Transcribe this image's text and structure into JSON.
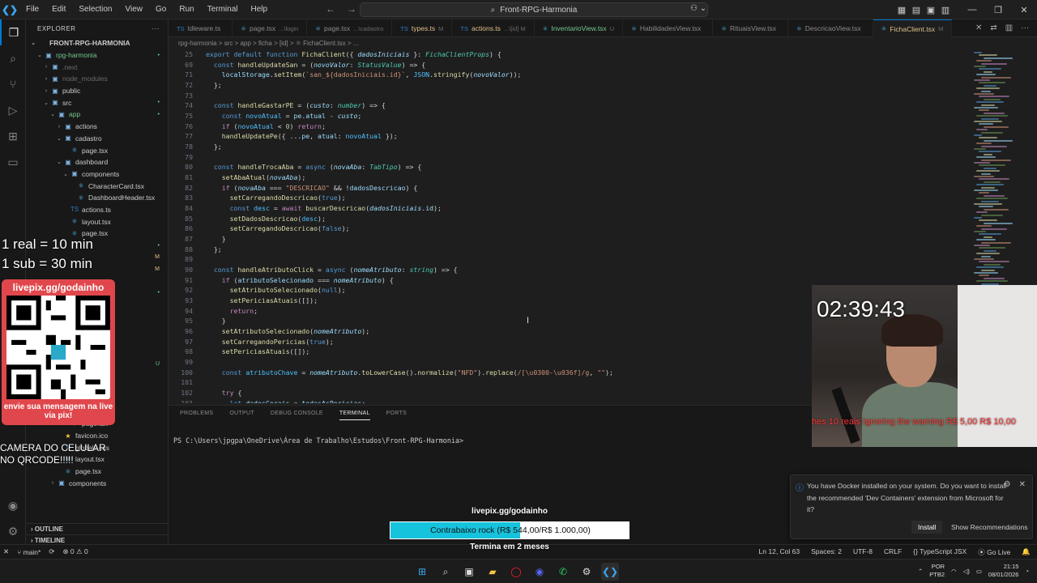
{
  "menu": [
    "File",
    "Edit",
    "Selection",
    "View",
    "Go",
    "Run",
    "Terminal",
    "Help"
  ],
  "search": {
    "text": "Front-RPG-Harmonia"
  },
  "sidebar": {
    "title": "EXPLORER",
    "rows": [
      {
        "label": "FRONT-RPG-HARMONIA",
        "indent": 0,
        "chev": "⌄",
        "icon": "",
        "color": "#ccc",
        "bold": true,
        "badge": ""
      },
      {
        "label": "rpg-harmonia",
        "indent": 1,
        "chev": "⌄",
        "icon": "▣",
        "color": "#73c991",
        "bold": false,
        "badge": "•"
      },
      {
        "label": ".next",
        "indent": 2,
        "chev": "›",
        "icon": "▣",
        "color": "#6b6b6b",
        "bold": false,
        "badge": ""
      },
      {
        "label": "node_modules",
        "indent": 2,
        "chev": "›",
        "icon": "▣",
        "color": "#6b6b6b",
        "bold": false,
        "badge": ""
      },
      {
        "label": "public",
        "indent": 2,
        "chev": "›",
        "icon": "▣",
        "color": "#ccc",
        "bold": false,
        "badge": ""
      },
      {
        "label": "src",
        "indent": 2,
        "chev": "⌄",
        "icon": "▣",
        "color": "#ccc",
        "bold": false,
        "badge": "•"
      },
      {
        "label": "app",
        "indent": 3,
        "chev": "⌄",
        "icon": "▣",
        "color": "#73c991",
        "bold": false,
        "badge": "•"
      },
      {
        "label": "actions",
        "indent": 4,
        "chev": "›",
        "icon": "▣",
        "color": "#ccc",
        "bold": false,
        "badge": ""
      },
      {
        "label": "cadastro",
        "indent": 4,
        "chev": "⌄",
        "icon": "▣",
        "color": "#ccc",
        "bold": false,
        "badge": ""
      },
      {
        "label": "page.tsx",
        "indent": 5,
        "chev": "",
        "icon": "⚛",
        "color": "#ccc",
        "bold": false,
        "badge": ""
      },
      {
        "label": "dashboard",
        "indent": 4,
        "chev": "⌄",
        "icon": "▣",
        "color": "#ccc",
        "bold": false,
        "badge": ""
      },
      {
        "label": "components",
        "indent": 5,
        "chev": "⌄",
        "icon": "▣",
        "color": "#ccc",
        "bold": false,
        "badge": ""
      },
      {
        "label": "CharacterCard.tsx",
        "indent": 6,
        "chev": "",
        "icon": "⚛",
        "color": "#ccc",
        "bold": false,
        "badge": ""
      },
      {
        "label": "DashboardHeader.tsx",
        "indent": 6,
        "chev": "",
        "icon": "⚛",
        "color": "#ccc",
        "bold": false,
        "badge": ""
      },
      {
        "label": "actions.ts",
        "indent": 5,
        "chev": "",
        "icon": "TS",
        "color": "#ccc",
        "bold": false,
        "badge": ""
      },
      {
        "label": "layout.tsx",
        "indent": 5,
        "chev": "",
        "icon": "⚛",
        "color": "#ccc",
        "bold": false,
        "badge": ""
      },
      {
        "label": "page.tsx",
        "indent": 5,
        "chev": "",
        "icon": "⚛",
        "color": "#ccc",
        "bold": false,
        "badge": ""
      },
      {
        "label": "",
        "indent": 4,
        "chev": "",
        "icon": "",
        "color": "#ccc",
        "bold": false,
        "badge": "•"
      },
      {
        "label": "",
        "indent": 4,
        "chev": "",
        "icon": "",
        "color": "#ccc",
        "bold": false,
        "badge": "M"
      },
      {
        "label": "",
        "indent": 4,
        "chev": "",
        "icon": "",
        "color": "#ccc",
        "bold": false,
        "badge": "M"
      },
      {
        "label": "",
        "indent": 4,
        "chev": "",
        "icon": "",
        "color": "#ccc",
        "bold": false,
        "badge": ""
      },
      {
        "label": "",
        "indent": 4,
        "chev": "",
        "icon": "",
        "color": "#ccc",
        "bold": false,
        "badge": "•"
      },
      {
        "label": ".tsx",
        "indent": 5,
        "chev": "",
        "icon": "",
        "color": "#ccc",
        "bold": false,
        "badge": ""
      },
      {
        "label": "w.tsx",
        "indent": 5,
        "chev": "",
        "icon": "",
        "color": "#ccc",
        "bold": false,
        "badge": ""
      },
      {
        "label": "ew.tsx",
        "indent": 5,
        "chev": "",
        "icon": "",
        "color": "#ccc",
        "bold": false,
        "badge": ""
      },
      {
        "label": "sx",
        "indent": 5,
        "chev": "",
        "icon": "",
        "color": "#ccc",
        "bold": false,
        "badge": ""
      },
      {
        "label": "em.tsx",
        "indent": 5,
        "chev": "",
        "icon": "",
        "color": "#ccc",
        "bold": false,
        "badge": ""
      },
      {
        "label": "w.tsx",
        "indent": 5,
        "chev": "",
        "icon": "",
        "color": "#73c991",
        "bold": false,
        "badge": "U"
      },
      {
        "label": "sx",
        "indent": 5,
        "chev": "",
        "icon": "",
        "color": "#ccc",
        "bold": false,
        "badge": ""
      },
      {
        "label": "arios.tsx",
        "indent": 5,
        "chev": "",
        "icon": "",
        "color": "#ccc",
        "bold": false,
        "badge": ""
      },
      {
        "label": "",
        "indent": 5,
        "chev": "",
        "icon": "",
        "color": "#ccc",
        "bold": false,
        "badge": ""
      },
      {
        "label": "layout.tsx",
        "indent": 5,
        "chev": "",
        "icon": "⚛",
        "color": "#ccc",
        "bold": false,
        "badge": ""
      },
      {
        "label": "page.tsx",
        "indent": 5,
        "chev": "",
        "icon": "⚛",
        "color": "#ccc",
        "bold": false,
        "badge": ""
      },
      {
        "label": "favicon.ico",
        "indent": 4,
        "chev": "",
        "icon": "★",
        "color": "#ccc",
        "bold": false,
        "badge": ""
      },
      {
        "label": "globals.css",
        "indent": 4,
        "chev": "",
        "icon": "#",
        "color": "#ccc",
        "bold": false,
        "badge": ""
      },
      {
        "label": "layout.tsx",
        "indent": 4,
        "chev": "",
        "icon": "⚛",
        "color": "#ccc",
        "bold": false,
        "badge": ""
      },
      {
        "label": "page.tsx",
        "indent": 4,
        "chev": "",
        "icon": "⚛",
        "color": "#ccc",
        "bold": false,
        "badge": ""
      },
      {
        "label": "components",
        "indent": 3,
        "chev": "›",
        "icon": "▣",
        "color": "#ccc",
        "bold": false,
        "badge": ""
      }
    ],
    "outline": "OUTLINE",
    "timeline": "TIMELINE"
  },
  "tabs": [
    {
      "label": "ldleware.ts",
      "hint": "",
      "state": "normal"
    },
    {
      "label": "page.tsx",
      "hint": "...\\login",
      "state": "normal"
    },
    {
      "label": "page.tsx",
      "hint": "...\\cadastro",
      "state": "normal"
    },
    {
      "label": "types.ts",
      "hint": "M",
      "state": "mod"
    },
    {
      "label": "actions.ts",
      "hint": "...\\[id] M",
      "state": "mod"
    },
    {
      "label": "InventarioView.tsx",
      "hint": "U",
      "state": "untr"
    },
    {
      "label": "HabilidadesView.tsx",
      "hint": "",
      "state": "normal"
    },
    {
      "label": "RituaisView.tsx",
      "hint": "",
      "state": "normal"
    },
    {
      "label": "DescricaoView.tsx",
      "hint": "",
      "state": "normal"
    },
    {
      "label": "FichaClient.tsx",
      "hint": "M",
      "state": "active"
    }
  ],
  "breadcrumb": "rpg-harmonia > src > app > ficha > [id] > ⚛ FichaClient.tsx > ...",
  "code": [
    {
      "n": "25",
      "t": "<span class=\"kw\">export default function</span> <span class=\"fn\">FichaClient</span>({ <span class=\"param\">dadosIniciais</span> }: <span class=\"ty\">FichaClientProps</span>) {"
    },
    {
      "n": "69",
      "t": "  <span class=\"kw\">const</span> <span class=\"fn\">handleUpdateSan</span> = (<span class=\"param\">novoValor</span>: <span class=\"ty\">StatusValue</span>) => {"
    },
    {
      "n": "71",
      "t": "    <span class=\"var\">localStorage</span>.<span class=\"fn\">setItem</span>(<span class=\"str\">`san_${dadosIniciais.id}`</span>, <span class=\"cst\">JSON</span>.<span class=\"fn\">stringify</span>(<span class=\"param\">novoValor</span>));"
    },
    {
      "n": "72",
      "t": "  };"
    },
    {
      "n": "73",
      "t": ""
    },
    {
      "n": "74",
      "t": "  <span class=\"kw\">const</span> <span class=\"fn\">handleGastarPE</span> = (<span class=\"param\">custo</span>: <span class=\"ty\">number</span>) => {"
    },
    {
      "n": "75",
      "t": "    <span class=\"kw\">const</span> <span class=\"cst\">novoAtual</span> = <span class=\"var\">pe</span>.<span class=\"var\">atual</span> - <span class=\"param\">custo</span>;"
    },
    {
      "n": "76",
      "t": "    <span class=\"ctl\">if</span> (<span class=\"cst\">novoAtual</span> < <span class=\"num\">0</span>) <span class=\"ctl\">return</span>;"
    },
    {
      "n": "77",
      "t": "    <span class=\"fn\">handleUpdatePe</span>({ ...<span class=\"var\">pe</span>, <span class=\"var\">atual</span>: <span class=\"cst\">novoAtual</span> });"
    },
    {
      "n": "78",
      "t": "  };"
    },
    {
      "n": "79",
      "t": ""
    },
    {
      "n": "80",
      "t": "  <span class=\"kw\">const</span> <span class=\"fn\">handleTrocaAba</span> = <span class=\"kw\">async</span> (<span class=\"param\">novaAba</span>: <span class=\"ty\">TabTipo</span>) => {"
    },
    {
      "n": "81",
      "t": "    <span class=\"fn\">setAbaAtual</span>(<span class=\"param\">novaAba</span>);"
    },
    {
      "n": "82",
      "t": "    <span class=\"ctl\">if</span> (<span class=\"param\">novaAba</span> === <span class=\"str\">\"DESCRICAO\"</span> && !<span class=\"var\">dadosDescricao</span>) {"
    },
    {
      "n": "83",
      "t": "      <span class=\"fn\">setCarregandoDescricao</span>(<span class=\"kw\">true</span>);"
    },
    {
      "n": "84",
      "t": "      <span class=\"kw\">const</span> <span class=\"cst\">desc</span> = <span class=\"ctl\">await</span> <span class=\"fn\">buscarDescricao</span>(<span class=\"param\">dadosIniciais</span>.<span class=\"var\">id</span>);"
    },
    {
      "n": "85",
      "t": "      <span class=\"fn\">setDadosDescricao</span>(<span class=\"cst\">desc</span>);"
    },
    {
      "n": "86",
      "t": "      <span class=\"fn\">setCarregandoDescricao</span>(<span class=\"kw\">false</span>);"
    },
    {
      "n": "87",
      "t": "    }"
    },
    {
      "n": "88",
      "t": "  };"
    },
    {
      "n": "89",
      "t": ""
    },
    {
      "n": "90",
      "t": "  <span class=\"kw\">const</span> <span class=\"fn\">handleAtributoClick</span> = <span class=\"kw\">async</span> (<span class=\"param\">nomeAtributo</span>: <span class=\"ty\">string</span>) => {"
    },
    {
      "n": "91",
      "t": "    <span class=\"ctl\">if</span> (<span class=\"var\">atributoSelecionado</span> === <span class=\"param\">nomeAtributo</span>) {"
    },
    {
      "n": "92",
      "t": "      <span class=\"fn\">setAtributoSelecionado</span>(<span class=\"kw\">null</span>);"
    },
    {
      "n": "93",
      "t": "      <span class=\"fn\">setPericiasAtuais</span>([]);"
    },
    {
      "n": "94",
      "t": "      <span class=\"ctl\">return</span>;"
    },
    {
      "n": "95",
      "t": "    }"
    },
    {
      "n": "96",
      "t": "    <span class=\"fn\">setAtributoSelecionado</span>(<span class=\"param\">nomeAtributo</span>);"
    },
    {
      "n": "97",
      "t": "    <span class=\"fn\">setCarregandoPericias</span>(<span class=\"kw\">true</span>);"
    },
    {
      "n": "98",
      "t": "    <span class=\"fn\">setPericiasAtuais</span>([]);"
    },
    {
      "n": "99",
      "t": ""
    },
    {
      "n": "100",
      "t": "    <span class=\"kw\">const</span> <span class=\"cst\">atributoChave</span> = <span class=\"param\">nomeAtributo</span>.<span class=\"fn\">toLowerCase</span>().<span class=\"fn\">normalize</span>(<span class=\"str\">\"NFD\"</span>).<span class=\"fn\">replace</span>(<span class=\"str\">/[\\u0300-\\u036f]/g</span>, <span class=\"str\">\"\"</span>);"
    },
    {
      "n": "101",
      "t": ""
    },
    {
      "n": "102",
      "t": "    <span class=\"ctl\">try</span> {"
    },
    {
      "n": "103",
      "t": "      <span class=\"kw\">let</span> <span class=\"var\">dadosGerais</span> = <span class=\"var\">todasAsPericias</span>;"
    }
  ],
  "panel": {
    "tabs": [
      "PROBLEMS",
      "OUTPUT",
      "DEBUG CONSOLE",
      "TERMINAL",
      "PORTS"
    ],
    "active": "TERMINAL",
    "prompt": "PS C:\\Users\\jpgpa\\OneDrive\\Área de Trabalho\\Estudos\\Front-RPG-Harmonia>"
  },
  "status": {
    "branch": "main*",
    "errors": "⊗ 0 ⚠ 0",
    "position": "Ln 12, Col 63",
    "spaces": "Spaces: 2",
    "encoding": "UTF-8",
    "eol": "CRLF",
    "language": "{} TypeScript JSX",
    "golive": "Go Live"
  },
  "taskbar": {
    "lang1": "POR",
    "lang2": "PTB2",
    "time": "21:15",
    "date": "08/01/2026"
  },
  "promo": {
    "line1": "1 real = 10 min",
    "line2": "1 sub = 30 min",
    "url": "livepix.gg/godainho",
    "msg": "envie sua mensagem na live via pix!",
    "camera": "CAMERA DO CELULAR NO QRCODE!!!!!"
  },
  "webcam": {
    "timer": "02:39:43",
    "ticker": "hes   10 reais   Ignoring the warning   R$ 5,00   R$ 10,00"
  },
  "notification": {
    "text": "You have Docker installed on your system. Do you want to install the recommended 'Dev Containers' extension from Microsoft for it?",
    "install": "Install",
    "recommend": "Show Recommendations"
  },
  "goal": {
    "url": "livepix.gg/godainho",
    "label": "Contrabaixo rock (R$ 544,00/R$ 1.000,00)",
    "progress": 0.544,
    "sub": "Termina em 2 meses"
  },
  "colors": {
    "accent": "#0078d4",
    "goal_fill": "#16c3dc",
    "promo_bg": "#e0474c"
  }
}
